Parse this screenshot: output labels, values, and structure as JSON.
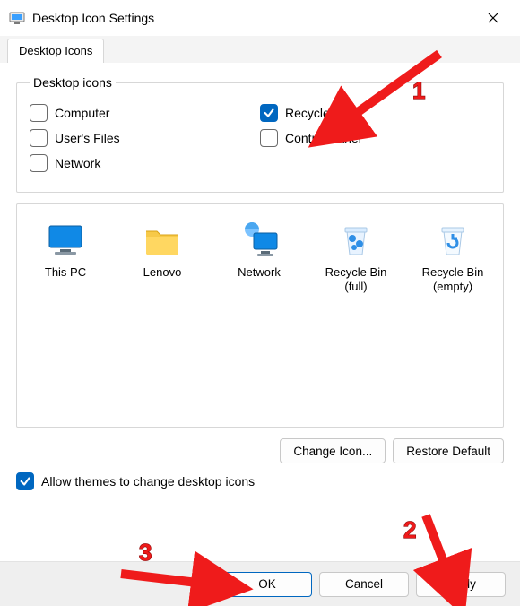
{
  "window": {
    "title": "Desktop Icon Settings"
  },
  "tab": {
    "label": "Desktop Icons"
  },
  "group": {
    "legend": "Desktop icons",
    "left": [
      {
        "label": "Computer",
        "checked": false
      },
      {
        "label": "User's Files",
        "checked": false
      },
      {
        "label": "Network",
        "checked": false
      }
    ],
    "right": [
      {
        "label": "Recycle Bin",
        "checked": true
      },
      {
        "label": "Control Panel",
        "checked": false
      }
    ]
  },
  "icons": [
    {
      "name": "This PC",
      "picto": "monitor"
    },
    {
      "name": "Lenovo",
      "picto": "folder"
    },
    {
      "name": "Network",
      "picto": "network"
    },
    {
      "name": "Recycle Bin\n(full)",
      "picto": "bin-full"
    },
    {
      "name": "Recycle Bin\n(empty)",
      "picto": "bin-empty"
    }
  ],
  "change_icon_label": "Change Icon...",
  "restore_default_label": "Restore Default",
  "allow_themes": {
    "label": "Allow themes to change desktop icons",
    "checked": true
  },
  "buttons": {
    "ok": "OK",
    "cancel": "Cancel",
    "apply": "Apply"
  },
  "annotations": {
    "a1": "1",
    "a2": "2",
    "a3": "3"
  }
}
